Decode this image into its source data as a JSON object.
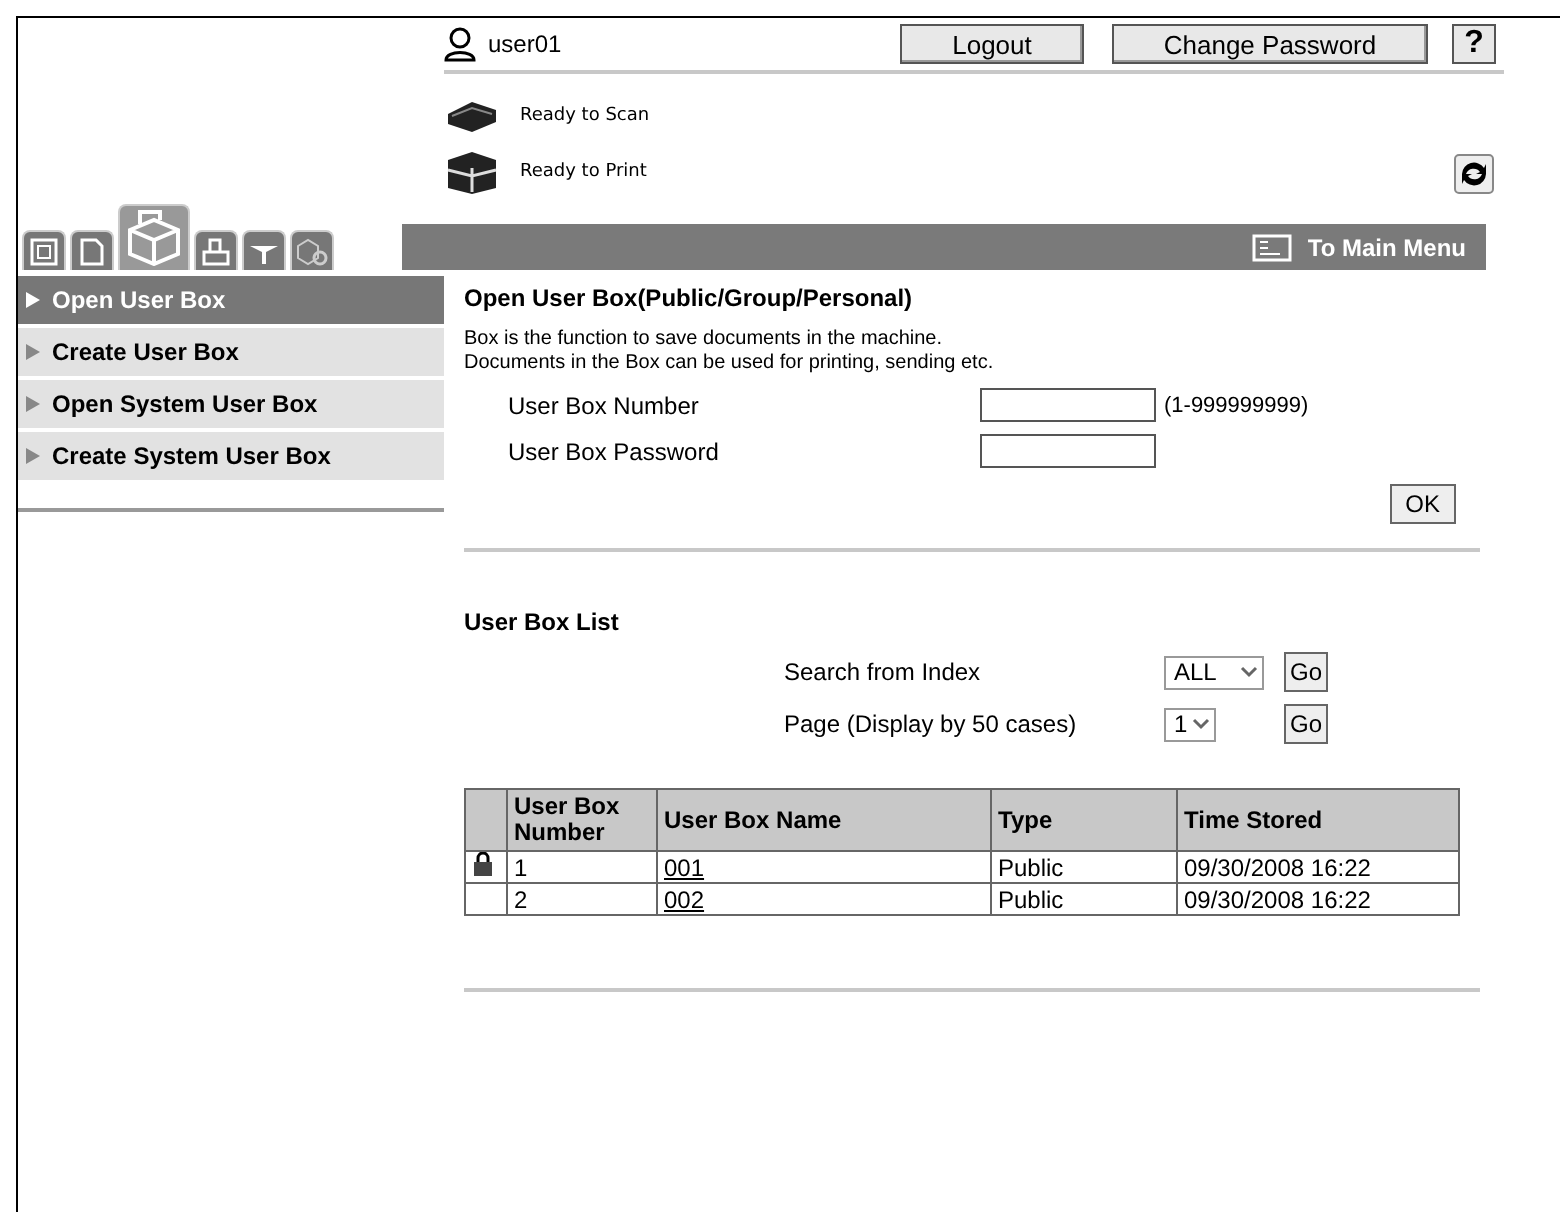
{
  "user": {
    "name": "user01"
  },
  "header_buttons": [
    {
      "label": "Logout"
    },
    {
      "label": "Change Password"
    }
  ],
  "help": {
    "label": "?"
  },
  "status": [
    {
      "kind": "scan",
      "label": "Ready to Scan"
    },
    {
      "kind": "print",
      "label": "Ready to Print"
    }
  ],
  "tabs": [
    {
      "kind": "info",
      "selected": false
    },
    {
      "kind": "job",
      "selected": false
    },
    {
      "kind": "box",
      "selected": true
    },
    {
      "kind": "direct",
      "selected": false
    },
    {
      "kind": "store",
      "selected": false
    },
    {
      "kind": "settings",
      "selected": false
    }
  ],
  "main_menu": {
    "label": "To Main Menu"
  },
  "sidebar": {
    "items": [
      {
        "label": "Open User Box",
        "selected": true
      },
      {
        "label": "Create User Box",
        "selected": false
      },
      {
        "label": "Open System User Box",
        "selected": false
      },
      {
        "label": "Create System User Box",
        "selected": false
      }
    ]
  },
  "open_box": {
    "title": "Open User Box(Public/Group/Personal)",
    "description": [
      "Box is the function to save documents in the machine.",
      "Documents in the Box can be used for printing, sending etc."
    ],
    "fields": [
      {
        "label": "User Box Number",
        "hint": "(1-999999999)"
      },
      {
        "label": "User Box Password"
      }
    ],
    "ok": "OK"
  },
  "list": {
    "title": "User Box List",
    "filters": [
      {
        "label": "Search from Index",
        "value": "ALL",
        "button": "Go"
      },
      {
        "label": "Page (Display by 50 cases)",
        "value": "1",
        "button": "Go"
      }
    ],
    "columns": [
      "User Box Number",
      "User Box Name",
      "Type",
      "Time Stored"
    ],
    "rows": [
      {
        "locked": true,
        "number": "1",
        "name": "001",
        "type": "Public",
        "time": "09/30/2008 16:22"
      },
      {
        "locked": false,
        "number": "2",
        "name": "002",
        "type": "Public",
        "time": "09/30/2008 16:22"
      }
    ]
  }
}
